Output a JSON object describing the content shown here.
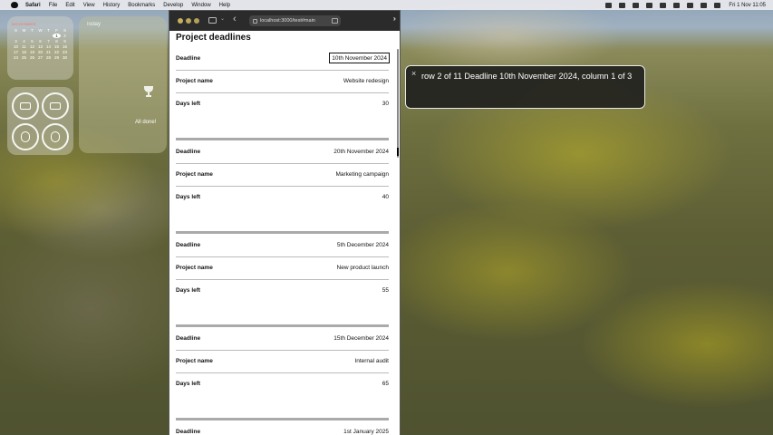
{
  "menubar": {
    "app": "Safari",
    "items": [
      "File",
      "Edit",
      "View",
      "History",
      "Bookmarks",
      "Develop",
      "Window",
      "Help"
    ],
    "clock": "Fri 1 Nov  11:05"
  },
  "calendar": {
    "month": "NOVEMBER",
    "days": [
      "S",
      "M",
      "T",
      "W",
      "T",
      "F",
      "S",
      "",
      "",
      "",
      "",
      "",
      "1",
      "2",
      "3",
      "4",
      "5",
      "6",
      "7",
      "8",
      "9",
      "10",
      "11",
      "12",
      "13",
      "14",
      "15",
      "16",
      "17",
      "18",
      "19",
      "20",
      "21",
      "22",
      "23",
      "24",
      "25",
      "26",
      "27",
      "28",
      "29",
      "30"
    ],
    "today": "1"
  },
  "reminders": {
    "title": "Today",
    "status": "All done!"
  },
  "browser": {
    "url": "localhost:3000/test#main",
    "page_title": "Project deadlines",
    "cards": [
      {
        "rows": [
          {
            "k": "Deadline",
            "v": "10th November 2024"
          },
          {
            "k": "Project name",
            "v": "Website redesign"
          },
          {
            "k": "Days left",
            "v": "30"
          }
        ]
      },
      {
        "rows": [
          {
            "k": "Deadline",
            "v": "20th November 2024"
          },
          {
            "k": "Project name",
            "v": "Marketing campaign"
          },
          {
            "k": "Days left",
            "v": "40"
          }
        ]
      },
      {
        "rows": [
          {
            "k": "Deadline",
            "v": "5th December 2024"
          },
          {
            "k": "Project name",
            "v": "New product launch"
          },
          {
            "k": "Days left",
            "v": "55"
          }
        ]
      },
      {
        "rows": [
          {
            "k": "Deadline",
            "v": "15th December 2024"
          },
          {
            "k": "Project name",
            "v": "Internal audit"
          },
          {
            "k": "Days left",
            "v": "65"
          }
        ]
      },
      {
        "rows": [
          {
            "k": "Deadline",
            "v": "1st January 2025"
          }
        ]
      }
    ]
  },
  "voiceover": {
    "caption": "row 2 of 11 Deadline 10th November 2024, column 1 of 3"
  }
}
